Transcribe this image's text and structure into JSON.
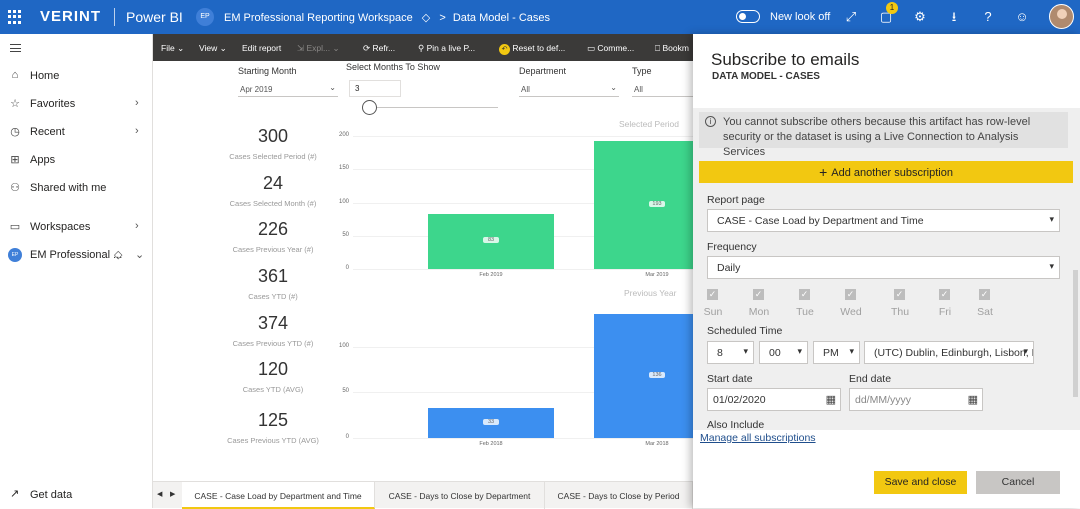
{
  "header": {
    "brand": "VERINT",
    "product": "Power BI",
    "workspace_badge": "EP",
    "workspace": "EM Professional Reporting Workspace",
    "separator": ">",
    "report": "Data Model - Cases",
    "new_look_label": "New look off",
    "notification_count": "1",
    "icons": [
      "app-launcher-icon",
      "expand-icon",
      "notifications-icon",
      "settings-icon",
      "download-icon",
      "help-icon",
      "feedback-icon"
    ]
  },
  "sidebar": {
    "items": [
      {
        "label": "Home",
        "icon": "home-icon"
      },
      {
        "label": "Favorites",
        "icon": "star-icon"
      },
      {
        "label": "Recent",
        "icon": "clock-icon"
      },
      {
        "label": "Apps",
        "icon": "apps-icon"
      },
      {
        "label": "Shared with me",
        "icon": "shared-icon"
      },
      {
        "label": "Workspaces",
        "icon": "workspaces-icon"
      },
      {
        "label": "EM Professional ...",
        "icon": "workspace-badge",
        "badge": "EP"
      }
    ],
    "get_data": "Get data"
  },
  "toolbar": {
    "file": "File",
    "view": "View",
    "edit": "Edit report",
    "explore": "Expl...",
    "refresh": "Refr...",
    "pin": "Pin a live P...",
    "reset": "Reset to def...",
    "comments": "Comme...",
    "bookmarks": "Bookm"
  },
  "filters": {
    "starting_month_label": "Starting Month",
    "starting_month_value": "Apr 2019",
    "months_label": "Select Months To Show",
    "months_value": "3",
    "department_label": "Department",
    "department_value": "All",
    "type_label": "Type",
    "type_value": "All"
  },
  "kpis": [
    {
      "value": "300",
      "label": "Cases Selected Period (#)"
    },
    {
      "value": "24",
      "label": "Cases Selected Month (#)"
    },
    {
      "value": "226",
      "label": "Cases Previous Year (#)"
    },
    {
      "value": "361",
      "label": "Cases YTD (#)"
    },
    {
      "value": "374",
      "label": "Cases Previous YTD (#)"
    },
    {
      "value": "120",
      "label": "Cases YTD (AVG)"
    },
    {
      "value": "125",
      "label": "Cases Previous YTD (AVG)"
    }
  ],
  "chart_data": [
    {
      "type": "bar",
      "title": "Selected Period",
      "categories": [
        "Feb 2019",
        "Mar 2019"
      ],
      "values": [
        83,
        193
      ],
      "data_labels": [
        "83",
        "193"
      ],
      "yticks": [
        "0",
        "50",
        "100",
        "150",
        "200"
      ],
      "ylim": [
        0,
        200
      ],
      "color": "#3dd68c",
      "grid": true
    },
    {
      "type": "bar",
      "title": "Previous Year",
      "categories": [
        "Feb 2018",
        "Mar 2018"
      ],
      "values": [
        33,
        136
      ],
      "data_labels": [
        "33",
        "136"
      ],
      "yticks": [
        "0",
        "50",
        "100"
      ],
      "ylim": [
        0,
        140
      ],
      "color": "#3c8ff0",
      "grid": true
    }
  ],
  "tabs": [
    {
      "label": "CASE - Case Load by Department and Time",
      "active": true
    },
    {
      "label": "CASE - Days to Close by Department",
      "active": false
    },
    {
      "label": "CASE - Days to Close by Period",
      "active": false
    }
  ],
  "subscribe": {
    "title": "Subscribe to emails",
    "subtitle": "DATA MODEL - CASES",
    "info": "You cannot subscribe others because this artifact has row-level security or the dataset is using a Live Connection to Analysis Services",
    "add_label": "Add another subscription",
    "report_page_label": "Report page",
    "report_page_value": "CASE - Case Load by Department and Time",
    "frequency_label": "Frequency",
    "frequency_value": "Daily",
    "days": [
      "Sun",
      "Mon",
      "Tue",
      "Wed",
      "Thu",
      "Fri",
      "Sat"
    ],
    "scheduled_time_label": "Scheduled Time",
    "hour": "8",
    "minute": "00",
    "ampm": "PM",
    "timezone": "(UTC) Dublin, Edinburgh, Lisbon, L",
    "start_date_label": "Start date",
    "start_date_value": "01/02/2020",
    "end_date_label": "End date",
    "end_date_placeholder": "dd/MM/yyyy",
    "also_include": "Also Include",
    "manage_link": "Manage all subscriptions",
    "save_label": "Save and close",
    "cancel_label": "Cancel"
  },
  "colors": {
    "topbar": "#1f67c4",
    "accent": "#f2c811",
    "toolbar": "#3b3a39"
  }
}
